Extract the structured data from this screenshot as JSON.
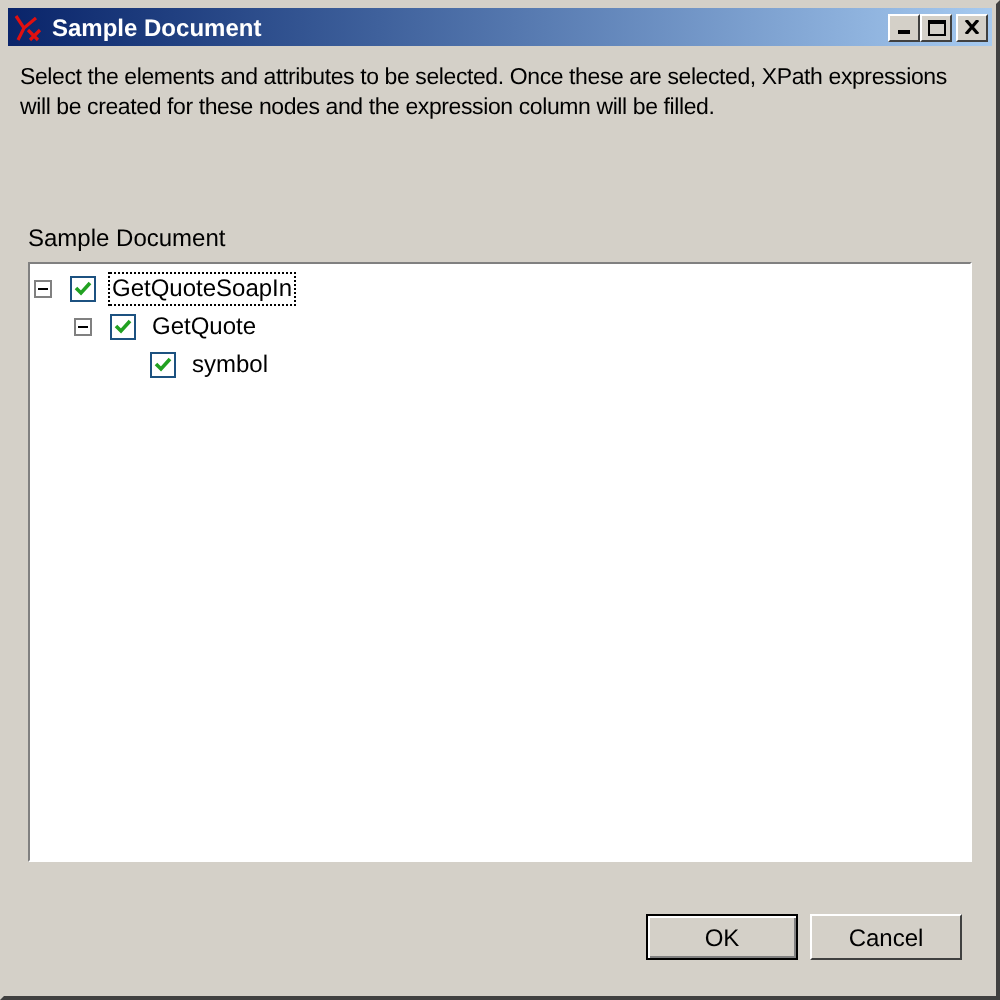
{
  "window": {
    "title": "Sample Document"
  },
  "description": "Select the elements and attributes to be selected. Once these are selected, XPath expressions will be created for these nodes and the expression column will be filled.",
  "tree": {
    "label": "Sample Document",
    "nodes": [
      {
        "label": "GetQuoteSoapIn",
        "checked": true,
        "expanded": true,
        "selected": true,
        "children": [
          {
            "label": "GetQuote",
            "checked": true,
            "expanded": true,
            "selected": false,
            "children": [
              {
                "label": "symbol",
                "checked": true,
                "selected": false
              }
            ]
          }
        ]
      }
    ]
  },
  "buttons": [
    {
      "label": "OK",
      "default": true
    },
    {
      "label": "Cancel",
      "default": false
    }
  ]
}
